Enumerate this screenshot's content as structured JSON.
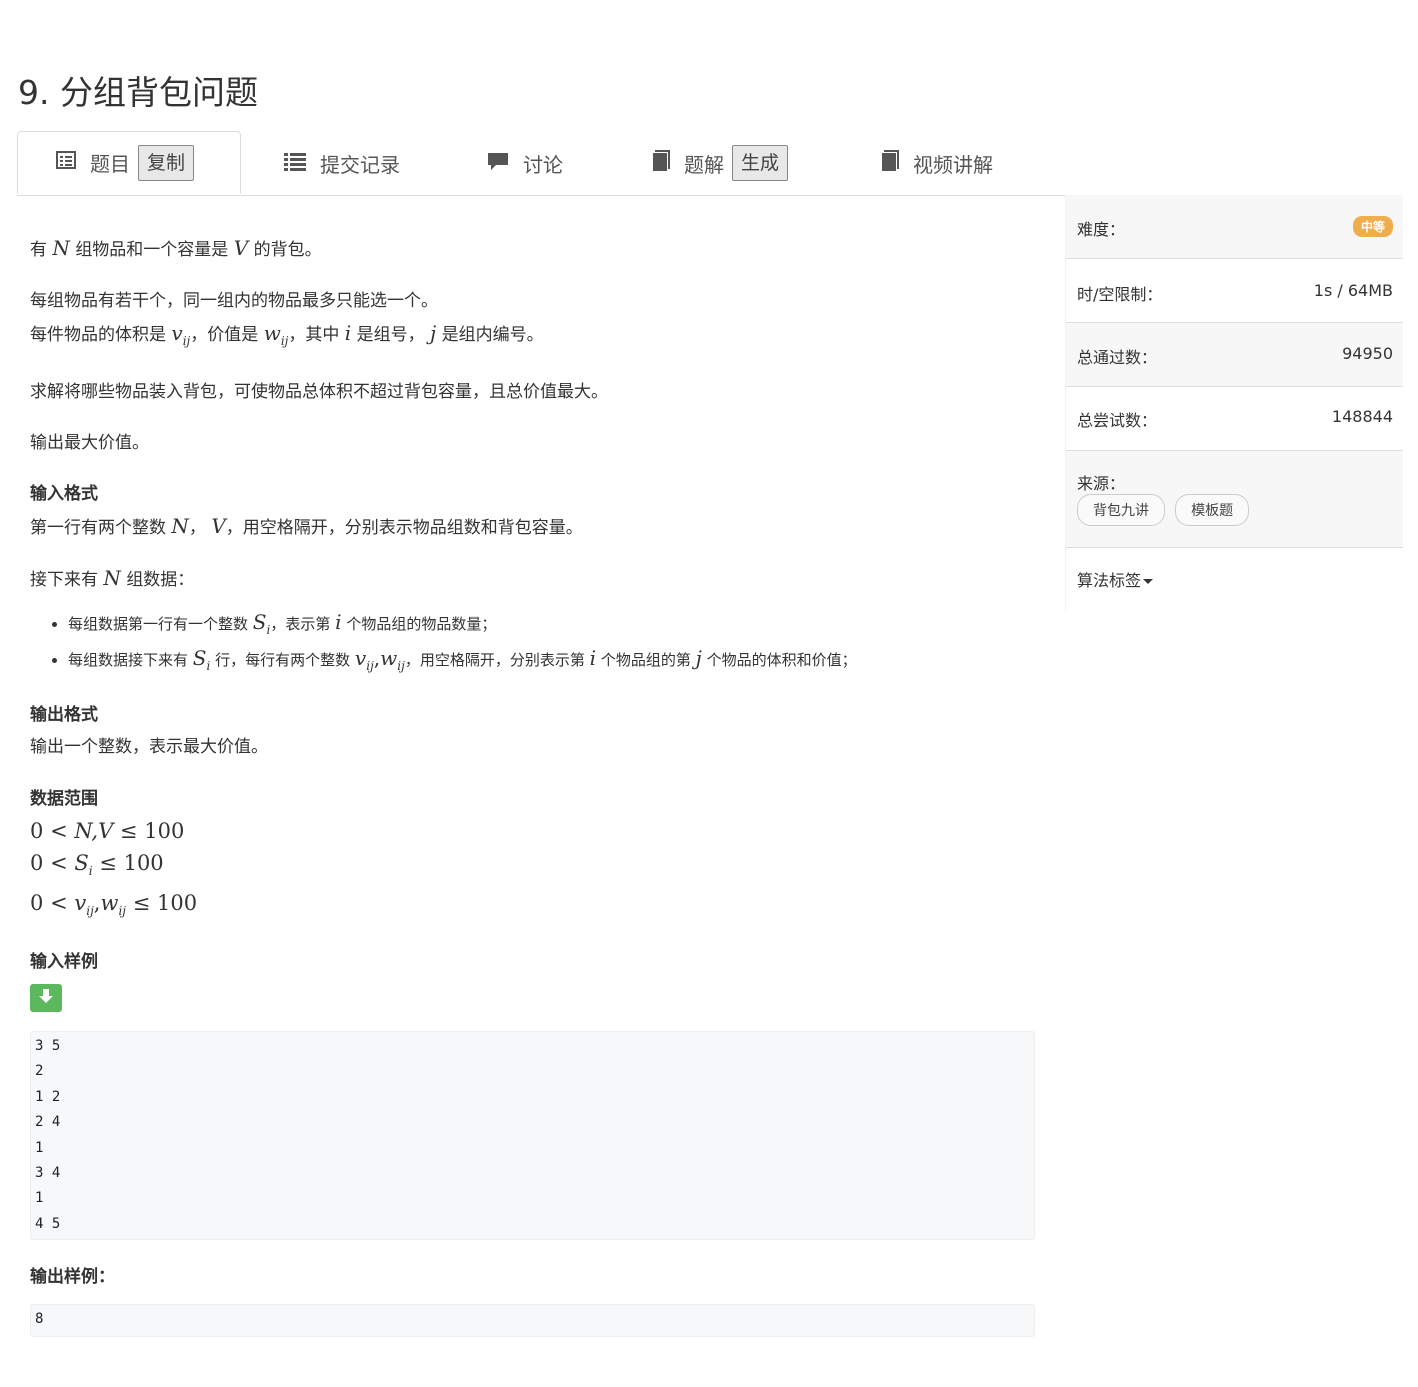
{
  "page": {
    "title": "9. 分组背包问题"
  },
  "tabs": [
    {
      "label": "题目",
      "button": "复制",
      "icon": "list-alt-icon"
    },
    {
      "label": "提交记录",
      "icon": "list-icon"
    },
    {
      "label": "讨论",
      "icon": "comment-icon"
    },
    {
      "label": "题解",
      "button": "生成",
      "icon": "book-icon"
    },
    {
      "label": "视频讲解",
      "icon": "book-icon"
    }
  ],
  "problem": {
    "p1_a": "有",
    "p1_m1": "N",
    "p1_b": "组物品和一个容量是",
    "p1_m2": "V",
    "p1_c": "的背包。",
    "p2_line1": "每组物品有若干个，同一组内的物品最多只能选一个。",
    "p2_a": "每件物品的体积是",
    "p2_v": "v",
    "p2_vsub": "ij",
    "p2_b": "，价值是",
    "p2_w": "w",
    "p2_wsub": "ij",
    "p2_c": "，其中",
    "p2_i": "i",
    "p2_d": "是组号，",
    "p2_j": "j",
    "p2_e": "是组内编号。",
    "p3": "求解将哪些物品装入背包，可使物品总体积不超过背包容量，且总价值最大。",
    "p4": "输出最大价值。",
    "input_heading": "输入格式",
    "in1_a": "第一行有两个整数",
    "in1_m1": "N",
    "in1_sep": "，",
    "in1_m2": "V",
    "in1_b": "，用空格隔开，分别表示物品组数和背包容量。",
    "in2_a": "接下来有",
    "in2_m": "N",
    "in2_b": "组数据：",
    "li1_a": "每组数据第一行有一个整数",
    "li1_s": "S",
    "li1_ssub": "i",
    "li1_b": "，表示第",
    "li1_i": "i",
    "li1_c": "个物品组的物品数量；",
    "li2_a": "每组数据接下来有",
    "li2_s": "S",
    "li2_ssub": "i",
    "li2_b": "行，每行有两个整数",
    "li2_v": "v",
    "li2_vsub": "ij",
    "li2_comma": ",",
    "li2_w": "w",
    "li2_wsub": "ij",
    "li2_c": "，用空格隔开，分别表示第",
    "li2_i": "i",
    "li2_d": "个物品组的第",
    "li2_j": "j",
    "li2_e": "个物品的体积和价值；",
    "output_heading": "输出格式",
    "out1": "输出一个整数，表示最大价值。",
    "range_heading": "数据范围",
    "r1_0": "0",
    "r1_lt": "<",
    "r1_nv": "N,V",
    "r1_le": "≤",
    "r1_100": "100",
    "r2_0": "0",
    "r2_lt": "<",
    "r2_s": "S",
    "r2_ssub": "i",
    "r2_le": "≤",
    "r2_100": "100",
    "r3_0": "0",
    "r3_lt": "<",
    "r3_v": "v",
    "r3_vsub": "ij",
    "r3_comma": ",",
    "r3_w": "w",
    "r3_wsub": "ij",
    "r3_le": "≤",
    "r3_100": "100",
    "sample_in_heading": "输入样例",
    "sample_in_lines": [
      "3 5",
      "2",
      "1 2",
      "2 4",
      "1",
      "3 4",
      "1",
      "4 5"
    ],
    "sample_out_heading": "输出样例：",
    "sample_out": "8"
  },
  "sidebar": {
    "difficulty_label": "难度：",
    "difficulty_value": "中等",
    "difficulty_color": "#f0ad4e",
    "limit_label": "时/空限制：",
    "limit_value": "1s / 64MB",
    "passed_label": "总通过数：",
    "passed_value": "94950",
    "tries_label": "总尝试数：",
    "tries_value": "148844",
    "source_label": "来源：",
    "source_tags": [
      "背包九讲",
      "模板题"
    ],
    "algo_label": "算法标签"
  }
}
